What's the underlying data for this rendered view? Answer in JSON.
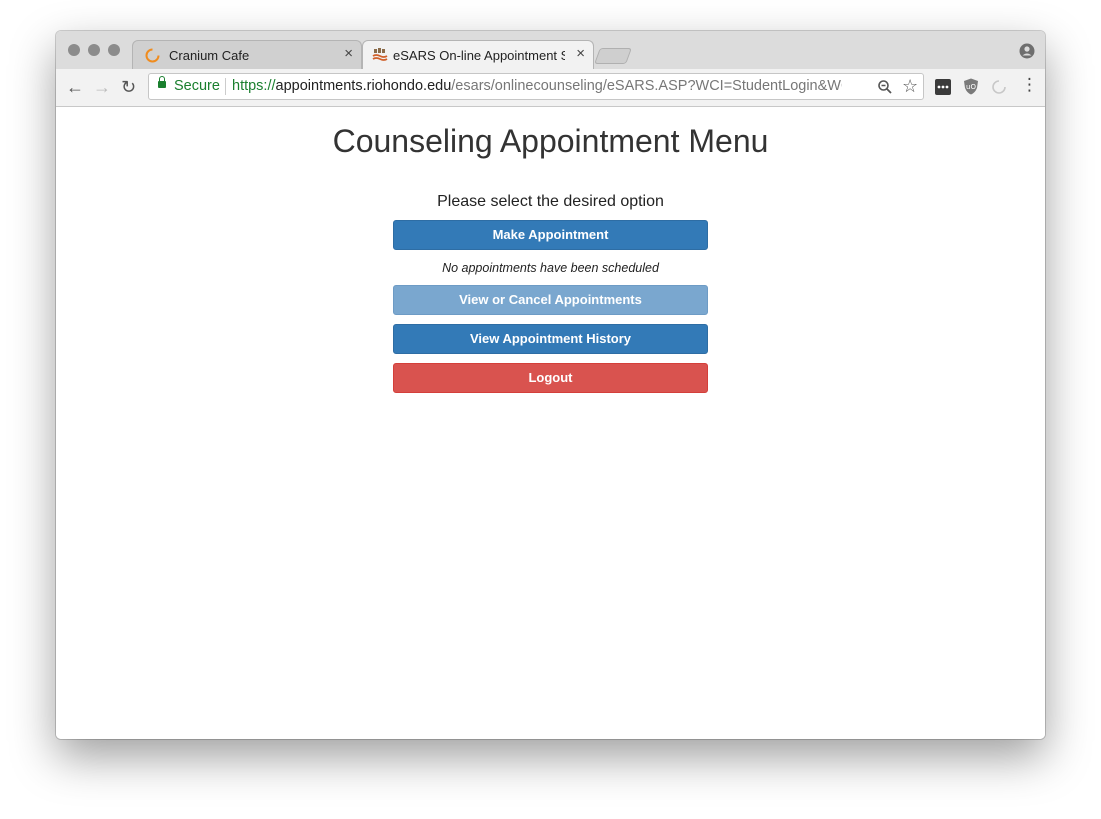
{
  "browser": {
    "tabs": [
      {
        "title": "Cranium Cafe",
        "icon": "loading-spinner-icon",
        "active": false
      },
      {
        "title": "eSARS On-line Appointment S",
        "icon": "esars-favicon",
        "active": true
      }
    ],
    "close_symbol": "×",
    "secure_label": "Secure",
    "url": {
      "scheme": "https://",
      "host": "appointments.riohondo.edu",
      "path": "/esars/onlinecounseling/eSARS.ASP?WCI=StudentLogin&WC..."
    },
    "accent_secure": "#1a7f2e"
  },
  "page": {
    "title": "Counseling Appointment Menu",
    "prompt": "Please select the desired option",
    "buttons": {
      "make": "Make Appointment",
      "view_cancel": "View or Cancel Appointments",
      "history": "View Appointment History",
      "logout": "Logout"
    },
    "status_note": "No appointments have been scheduled",
    "colors": {
      "primary": "#337ab7",
      "disabled": "#7aa7cf",
      "danger": "#d9534f"
    }
  }
}
